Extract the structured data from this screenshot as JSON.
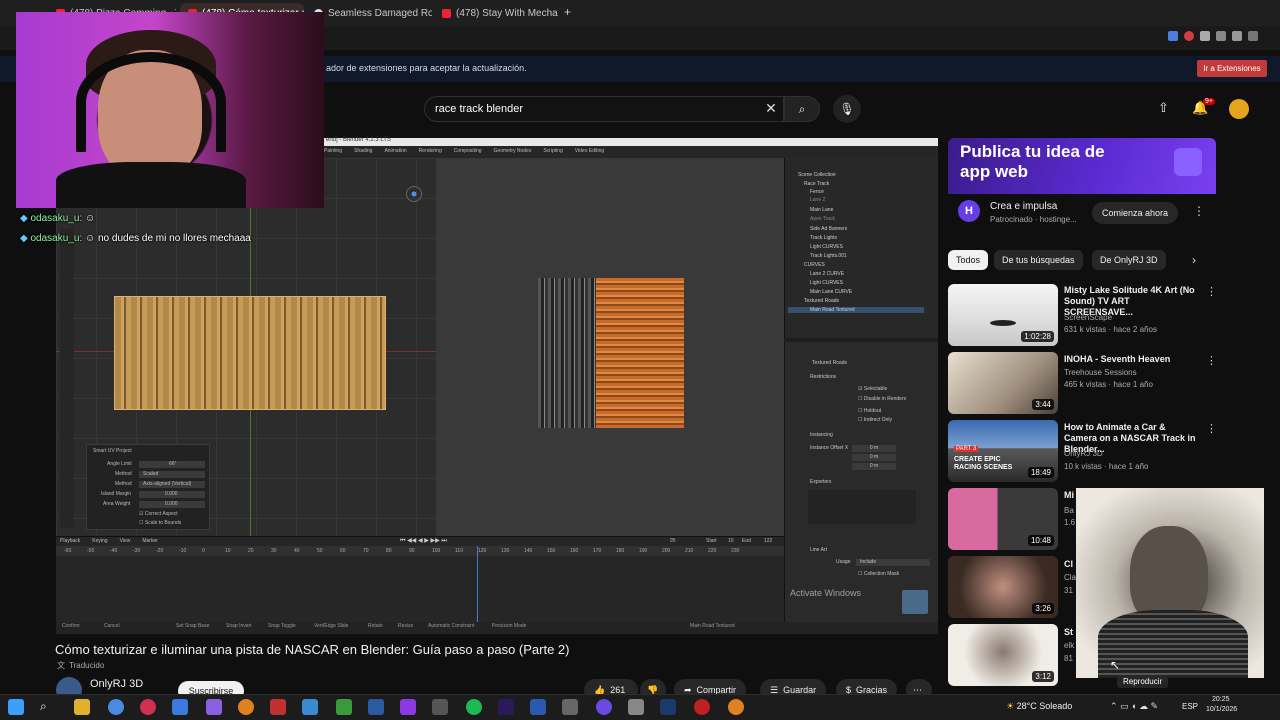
{
  "browser": {
    "tabs": [
      {
        "label": "(478) Pizza Comming - Y..."
      },
      {
        "label": "(478) Cómo texturizar e i..."
      },
      {
        "label": "Seamless Damaged Road..."
      },
      {
        "label": "(478) Stay With Mecha - Y..."
      }
    ],
    "new_tab": "+",
    "extension_notice": "ador de extensiones para aceptar la actualización.",
    "extension_button": "Ir a Extensiones"
  },
  "stream_overlay": {
    "chat": [
      {
        "user": "odasaku_u:",
        "message": ""
      },
      {
        "user": "odasaku_u:",
        "message": "no dudes de mi no llores mechaaa"
      }
    ]
  },
  "youtube": {
    "search": {
      "query": "race track blender"
    },
    "notification_count": "9+",
    "video": {
      "title": "Cómo texturizar e iluminar una pista de NASCAR en Blender: Guía paso a paso (Parte 2)",
      "translated": "Traducido",
      "channel": "OnlyRJ 3D",
      "subscribe": "Suscribirse",
      "likes": "261",
      "share": "Compartir",
      "save": "Guardar",
      "thanks": "Gracias"
    },
    "ad": {
      "headline": "Publica tu idea de app web",
      "title": "Crea e impulsa",
      "sponsor": "Patrocinado · hostinge...",
      "cta": "Comienza ahora",
      "logo_letter": "H"
    },
    "chips": [
      {
        "label": "Todos"
      },
      {
        "label": "De tus búsquedas"
      },
      {
        "label": "De OnlyRJ 3D"
      }
    ],
    "related": [
      {
        "title": "Misty Lake Solitude 4K Art (No Sound) TV ART SCREENSAVE...",
        "channel": "ScreenScape",
        "meta": "631 k vistas · hace 2 años",
        "duration": "1:02:28"
      },
      {
        "title": "INOHA - Seventh Heaven",
        "channel": "Treehouse Sessions",
        "meta": "465 k vistas · hace 1 año",
        "duration": "3:44"
      },
      {
        "title": "How to Animate a Car & Camera on a NASCAR Track in Blender...",
        "channel": "OnlyRJ 3D",
        "meta": "10 k vistas · hace 1 año",
        "duration": "18:49",
        "thumb_text": "CREATE EPIC RACING SCENES",
        "thumb_part": "PART 3"
      },
      {
        "title": "Mi",
        "channel": "Ba",
        "meta": "1.6",
        "duration": "10:48"
      },
      {
        "title": "Cl",
        "channel": "Cla",
        "meta": "31",
        "duration": "3:26"
      },
      {
        "title": "St",
        "channel": "elk",
        "meta": "81",
        "duration": "3:12"
      }
    ],
    "hover_tooltip": "Reproducir"
  },
  "blender": {
    "title": "end] - Blender 4.2.3 LTS",
    "menus": [
      "Painting",
      "Shading",
      "Animation",
      "Rendering",
      "Compositing",
      "Geometry Nodes",
      "Scripting",
      "Video Editing"
    ],
    "uv_panel": {
      "header": "Smart UV Project",
      "rows": [
        {
          "label": "Angle Limit",
          "value": "66°"
        },
        {
          "label": "Method",
          "value": "Scaled"
        },
        {
          "label": "Method",
          "value": "Axis-aligned (Vertical)"
        },
        {
          "label": "Island Margin",
          "value": "0.000"
        },
        {
          "label": "Area Weight",
          "value": "0.000"
        }
      ],
      "checkboxes": [
        "Correct Aspect",
        "Scale to Bounds"
      ]
    },
    "outliner": [
      "Scene Collection",
      "Race Track",
      "Fence",
      "Lane 2",
      "Main Lane",
      "Apex Track",
      "Side Ad Banners",
      "Track Lights",
      "Light CURVES",
      "Track Lights.001",
      "CURVES",
      "Lane 2 CURVE",
      "Light CURVES",
      "Main Lane CURVE",
      "Textured Roads",
      "Main Road Textured"
    ],
    "properties": {
      "object": "Textured Roads",
      "sections": [
        "Restrictions",
        "Instancing",
        "Exporters",
        "Line Art"
      ],
      "restrictions": [
        "Selectable",
        "Disable in Renders",
        "Holdout",
        "Indirect Only"
      ],
      "instance_offset": "Instance Offset X",
      "offset_values": [
        "0 m",
        "0 m",
        "0 m"
      ],
      "usage_label": "Usage",
      "usage_value": "Include",
      "collection_mask": "Collection Mask"
    },
    "timeline": {
      "menus": [
        "Playback",
        "Keying",
        "View",
        "Marker"
      ],
      "start": "Start",
      "start_value": "10",
      "end": "End",
      "end_value": "122",
      "current_frame": "95",
      "ticks": [
        "-60",
        "-50",
        "-40",
        "-30",
        "-20",
        "-10",
        "0",
        "10",
        "20",
        "30",
        "40",
        "50",
        "60",
        "70",
        "80",
        "90",
        "100",
        "110",
        "120",
        "130",
        "140",
        "150",
        "160",
        "170",
        "180",
        "190",
        "200",
        "210",
        "220",
        "230"
      ]
    },
    "status": [
      "Confirm",
      "Cancel",
      "Set Snap Base",
      "Snap Invert",
      "Snap Toggle",
      "Vert/Edge Slide",
      "Rotate",
      "Resize",
      "Automatic Constraint",
      "Precision Mode"
    ],
    "status_right": "Main Road Textured",
    "watermark": "Activate Windows"
  },
  "taskbar": {
    "weather": "28°C Soleado",
    "language": "ESP",
    "time": "20:25",
    "date": "10/1/2026"
  }
}
